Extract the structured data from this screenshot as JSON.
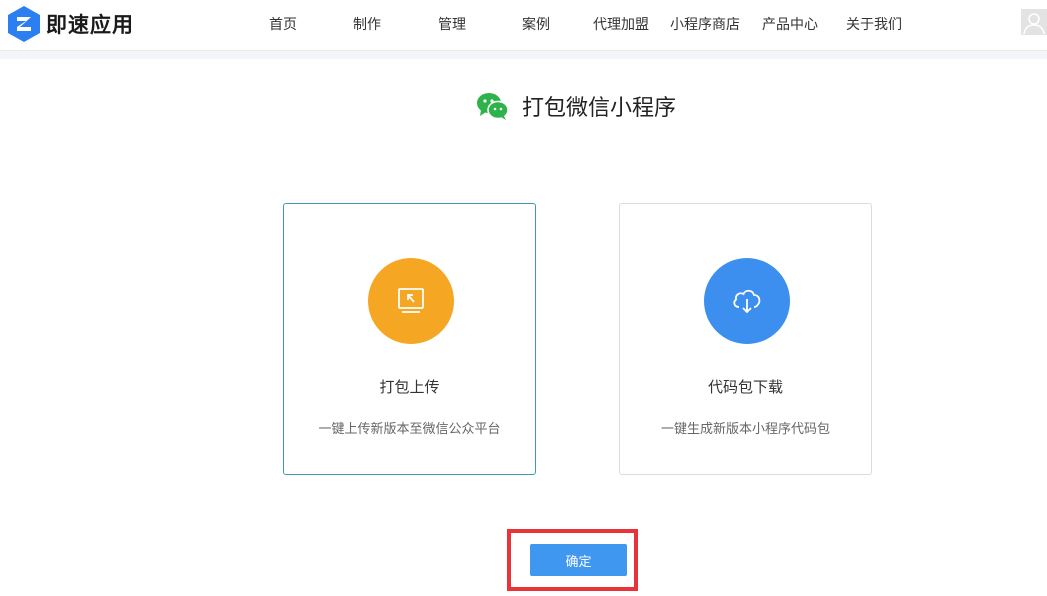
{
  "brand": {
    "name": "即速应用",
    "color": "#2c7ff0"
  },
  "nav": {
    "items": [
      {
        "label": "首页"
      },
      {
        "label": "制作"
      },
      {
        "label": "管理"
      },
      {
        "label": "案例"
      },
      {
        "label": "代理加盟"
      },
      {
        "label": "小程序商店"
      },
      {
        "label": "产品中心"
      },
      {
        "label": "关于我们"
      }
    ]
  },
  "user": {
    "avatar_icon": "user-icon"
  },
  "page": {
    "title": "打包微信小程序",
    "title_icon": "wechat-icon",
    "title_icon_color": "#2db34a"
  },
  "options": [
    {
      "title": "打包上传",
      "description": "一键上传新版本至微信公众平台",
      "icon": "upload-screen-icon",
      "color": "#f5a623",
      "selected": true
    },
    {
      "title": "代码包下载",
      "description": "一键生成新版本小程序代码包",
      "icon": "cloud-download-icon",
      "color": "#3d8fef",
      "selected": false
    }
  ],
  "actions": {
    "confirm_label": "确定",
    "confirm_color": "#3f97f0",
    "highlight_color": "#e8333a"
  }
}
